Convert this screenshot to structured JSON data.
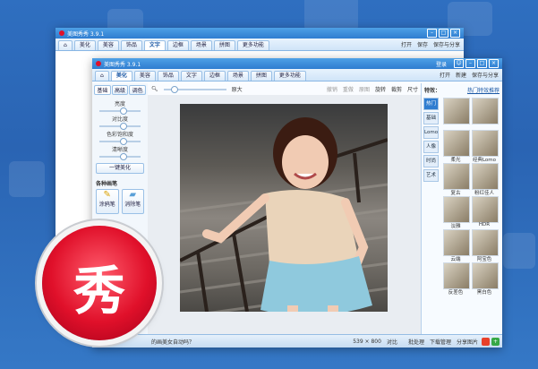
{
  "back_window": {
    "title": "美图秀秀 3.9.1",
    "tabs": [
      "美化",
      "美容",
      "饰品",
      "文字",
      "边框",
      "场景",
      "拼图",
      "更多功能"
    ],
    "active_tab": 4,
    "header_buttons": [
      "打开",
      "保存",
      "保存与分享"
    ]
  },
  "front_window": {
    "title": "美图秀秀 3.9.1",
    "title_right": "登录",
    "tabs": [
      "美化",
      "美容",
      "饰品",
      "文字",
      "边框",
      "场景",
      "拼图",
      "更多功能"
    ],
    "header_buttons": [
      "打开",
      "新建",
      "保存与分享"
    ],
    "sidebar": {
      "tabs": [
        "基础",
        "高级",
        "调色"
      ],
      "sliders": [
        "亮度",
        "对比度",
        "色彩饱和度",
        "清晰度"
      ],
      "one_click_button": "一键美化",
      "tools_title": "各种画笔",
      "tools": [
        "涂鸦笔",
        "消除笔"
      ]
    },
    "toolbar": {
      "items": [
        "原大",
        "撤销",
        "重做",
        "原图",
        "旋转",
        "裁剪",
        "尺寸"
      ]
    },
    "right_panel": {
      "title": "特效：",
      "link": "热门特效推荐",
      "categories": [
        "热门",
        "基础",
        "Lomo",
        "人像",
        "时尚",
        "艺术"
      ],
      "active_category": 0,
      "effects": [
        "",
        "",
        "柔光",
        "经典Lomo",
        "复古",
        "粉红佳人",
        "淡雅",
        "HDR",
        "云端",
        "阿宝色",
        "反差色",
        "黑白色"
      ]
    },
    "status": {
      "size": "539 × 800",
      "compare": "对比",
      "prompt": "的画美女自动吗？",
      "right_items": [
        "批处理",
        "下载管理",
        "分享图片"
      ]
    }
  },
  "logo_char": "秀",
  "colors": {
    "accent": "#2f7dd0",
    "logo_red": "#e0102a"
  }
}
